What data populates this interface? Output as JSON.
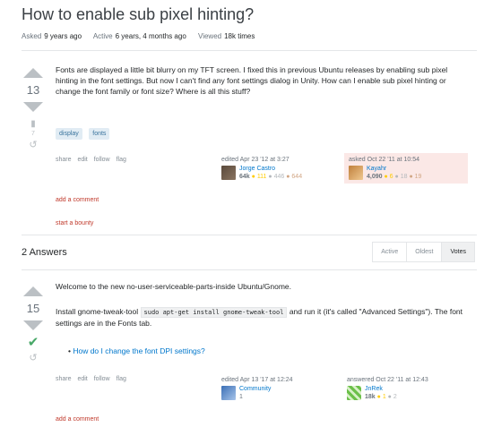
{
  "question": {
    "title": "How to enable sub pixel hinting?",
    "meta": {
      "asked_label": "Asked",
      "asked_value": "9 years ago",
      "active_label": "Active",
      "active_value": "6 years, 4 months ago",
      "viewed_label": "Viewed",
      "viewed_value": "18k times"
    },
    "score": "13",
    "bookmark_count": "7",
    "body": "Fonts are displayed a little bit blurry on my TFT screen. I fixed this in previous Ubuntu releases by enabling sub pixel hinting in the font settings. But now I can't find any font settings dialog in Unity. How can I enable sub pixel hinting or change the font family or font size? Where is all this stuff?",
    "tags": [
      "display",
      "fonts"
    ],
    "menu": [
      "share",
      "edit",
      "follow",
      "flag"
    ],
    "editor": {
      "when": "edited Apr 23 '12 at 3:27",
      "name": "Jorge Castro",
      "rep": "64k",
      "gold": "● 111",
      "silver": "● 446",
      "bronze": "● 644"
    },
    "owner": {
      "when": "asked Oct 22 '11 at 10:54",
      "name": "Kayahr",
      "rep": "4,090",
      "gold": "● 6",
      "silver": "● 18",
      "bronze": "● 19"
    },
    "add_comment": "add a comment",
    "start_bounty": "start a bounty"
  },
  "answers_header": "2 Answers",
  "sort_tabs": [
    "Active",
    "Oldest",
    "Votes"
  ],
  "answer1": {
    "score": "15",
    "p1": "Welcome to the new no-user-serviceable-parts-inside Ubuntu/Gnome.",
    "p2_before": "Install gnome-tweak-tool",
    "p2_code": "sudo apt-get install gnome-tweak-tool",
    "p2_after": "and run it (it's called \"Advanced Settings\"). The font settings are in the Fonts tab.",
    "bullet": "How do I change the font DPI settings?",
    "menu": [
      "share",
      "edit",
      "follow",
      "flag"
    ],
    "editor": {
      "when": "edited Apr 13 '17 at 12:24",
      "name": "Community",
      "rep": "1"
    },
    "author": {
      "when": "answered Oct 22 '11 at 12:43",
      "name": "JnRek",
      "rep": "18k",
      "gold": "● 1",
      "silver": "● 2"
    },
    "add_comment": "add a comment"
  }
}
